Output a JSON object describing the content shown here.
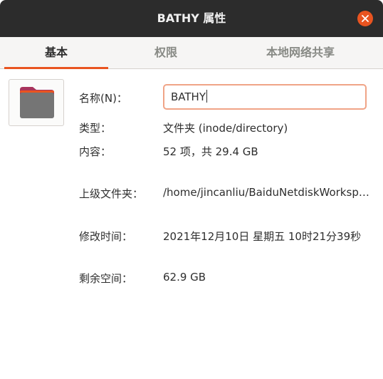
{
  "window": {
    "title": "BATHY 属性"
  },
  "icons": {
    "close": "close-icon",
    "folder": "folder-icon"
  },
  "colors": {
    "accent": "#e95420",
    "titlebar": "#2c2c2c",
    "folder_tab": "#a8345c",
    "folder_body": "#757575"
  },
  "tabs": [
    {
      "label": "基本",
      "active": true
    },
    {
      "label": "权限",
      "active": false
    },
    {
      "label": "本地网络共享",
      "active": false
    }
  ],
  "basic": {
    "name_label": "名称(N)：",
    "name_value": "BATHY",
    "type_label": "类型：",
    "type_value": "文件夹 (inode/directory)",
    "contents_label": "内容：",
    "contents_value": "52 项，共 29.4 GB",
    "parent_label": "上级文件夹：",
    "parent_value": "/home/jincanliu/BaiduNetdiskWorkspace/…",
    "modified_label": "修改时间：",
    "modified_value": "2021年12月10日 星期五 10时21分39秒",
    "free_label": "剩余空间：",
    "free_value": "62.9 GB"
  }
}
